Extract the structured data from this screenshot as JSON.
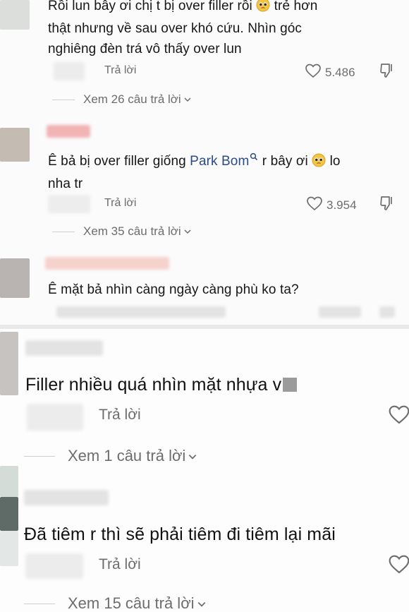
{
  "comments_top": [
    {
      "text_part1": "Rồi lun bây ơi chị t bị over filler rồi",
      "text_part2": "trẻ hơn",
      "text_line2": "thật nhưng về sau over khó cứu. Nhìn góc",
      "text_line3": "nghiêng đèn trá vô thấy over lun",
      "reply_label": "Trả lời",
      "likes": "5.486",
      "view_more": "Xem 26 câu trả lời"
    },
    {
      "text_before_mention": "Ê bả bị over filler giống",
      "mention": "Park Bom",
      "text_after_mention": "r bây ơi",
      "text_end": "lo",
      "text_line2": "nha tr",
      "reply_label": "Trả lời",
      "likes": "3.954",
      "view_more": "Xem 35 câu trả lời"
    },
    {
      "text": "Ê mặt bả nhìn càng ngày càng phù ko ta?"
    }
  ],
  "comments_bottom": [
    {
      "text": "Filler nhiều quá nhìn mặt nhựa v",
      "reply_label": "Trả lời",
      "view_more": "Xem 1 câu trả lời"
    },
    {
      "text": "Đã tiêm r thì sẽ phải tiêm đi tiêm lại mãi",
      "reply_label": "Trả lời",
      "view_more": "Xem 15 câu trả lời"
    }
  ],
  "colors": {
    "text": "#161616",
    "muted": "#6d6d6d",
    "mention": "#2a4a8c",
    "background": "#ffffff"
  },
  "icons": [
    "pleading-face-emoji",
    "search-icon",
    "heart-icon",
    "dislike-icon",
    "chevron-down-icon"
  ]
}
